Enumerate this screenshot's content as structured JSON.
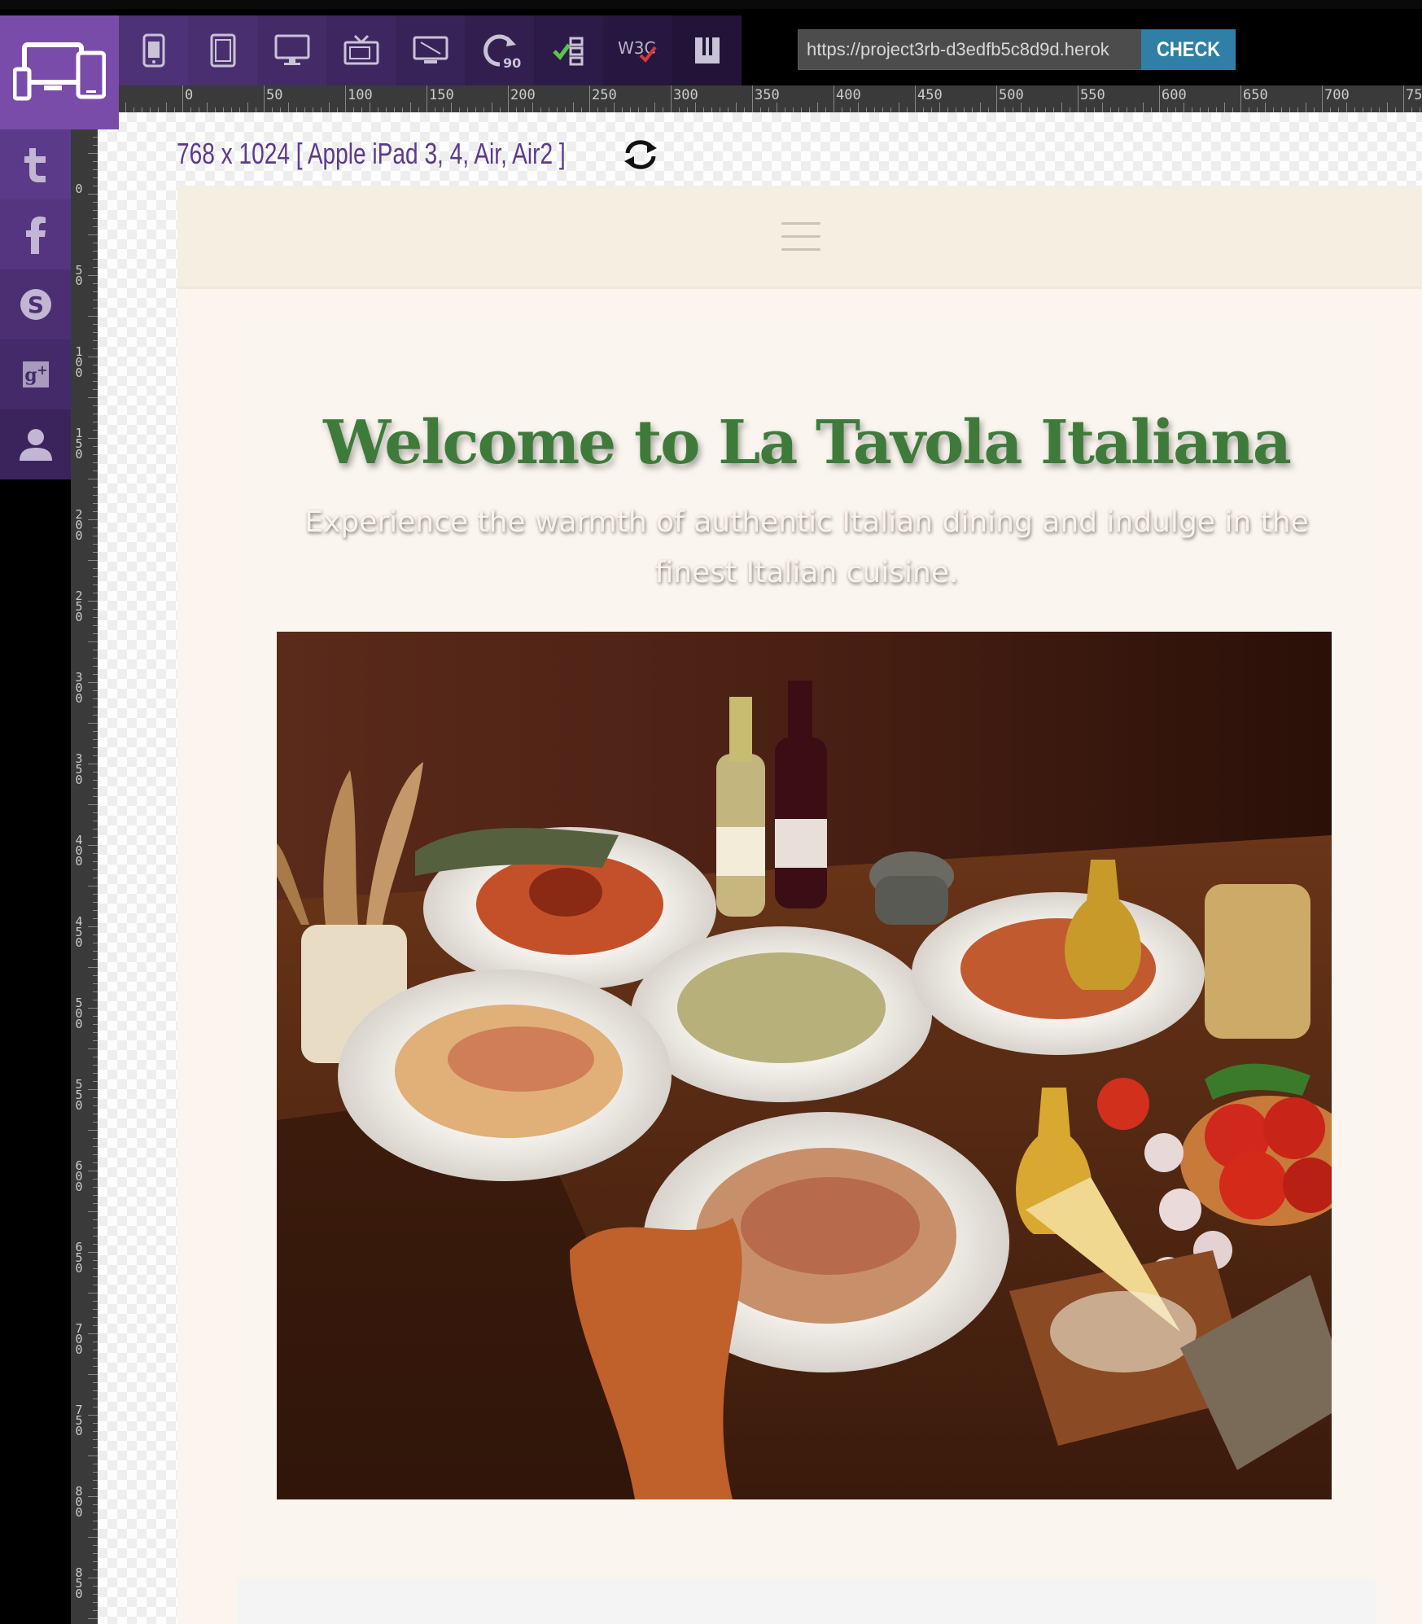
{
  "toolbar": {
    "devices": [
      {
        "name": "phone-icon"
      },
      {
        "name": "tablet-icon"
      },
      {
        "name": "desktop-icon"
      },
      {
        "name": "tv-icon"
      },
      {
        "name": "widescreen-icon"
      },
      {
        "name": "rotate-90-icon",
        "label": "90°"
      },
      {
        "name": "validate-icon"
      },
      {
        "name": "w3c-icon",
        "label": "W3C"
      },
      {
        "name": "book-icon"
      }
    ],
    "url_value": "https://project3rb-d3edfb5c8d9d.herok",
    "check_label": "CHECK"
  },
  "ruler": {
    "h_labels": [
      "0",
      "50",
      "100",
      "150",
      "200",
      "250",
      "300",
      "350",
      "400",
      "450",
      "500",
      "550",
      "600",
      "650",
      "700",
      "75"
    ],
    "v_labels": [
      "0",
      "50",
      "100",
      "150",
      "200",
      "250",
      "300",
      "350",
      "400",
      "450",
      "500",
      "550",
      "600",
      "650",
      "700",
      "750",
      "800",
      "850"
    ]
  },
  "social": [
    "tumblr-icon",
    "facebook-icon",
    "skype-icon",
    "google-plus-icon",
    "user-icon"
  ],
  "device_label": "768 x 1024 [ Apple iPad 3, 4, Air, Air2 ]",
  "site": {
    "title": "Welcome to La Tavola Italiana",
    "subtitle": "Experience the warmth of authentic Italian dining and indulge in the finest Italian cuisine."
  },
  "colors": {
    "brand_purple": "#7a4caa",
    "check_blue": "#2f7fa6",
    "title_green": "#3e7b3a",
    "nav_beige": "#f5efe2"
  }
}
